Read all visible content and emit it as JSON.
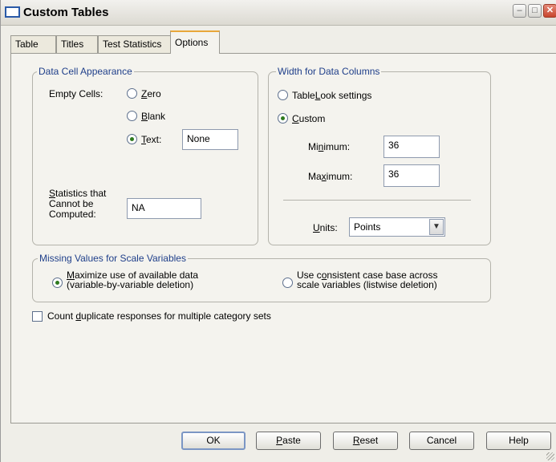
{
  "window": {
    "title": "Custom Tables",
    "controls": {
      "minimize": "–",
      "maximize": "□",
      "close": "✕"
    }
  },
  "tabs": [
    {
      "label": "Table",
      "active": false
    },
    {
      "label": "Titles",
      "active": false
    },
    {
      "label": "Test Statistics",
      "active": false
    },
    {
      "label": "Options",
      "active": true
    }
  ],
  "data_cell": {
    "legend": "Data Cell Appearance",
    "empty_cells_label": "Empty Cells:",
    "opt_zero": {
      "pre": "",
      "key": "Z",
      "post": "ero",
      "selected": false
    },
    "opt_blank": {
      "pre": "",
      "key": "B",
      "post": "lank",
      "selected": false
    },
    "opt_text": {
      "pre": "",
      "key": "T",
      "post": "ext:",
      "selected": true
    },
    "text_value": "None",
    "stats_label_key": "S",
    "stats_label_line1": "tatistics that",
    "stats_label_line2": "Cannot be",
    "stats_label_line3": "Computed:",
    "stats_value": "NA"
  },
  "width_cols": {
    "legend": "Width for Data Columns",
    "opt_tablelook": {
      "pre": "Table",
      "key": "L",
      "post": "ook settings",
      "selected": false
    },
    "opt_custom": {
      "pre": "",
      "key": "C",
      "post": "ustom",
      "selected": true
    },
    "min_label": {
      "pre": "Mi",
      "key": "n",
      "post": "imum:"
    },
    "min_value": "36",
    "max_label": {
      "pre": "Ma",
      "key": "x",
      "post": "imum:"
    },
    "max_value": "36",
    "units_label": {
      "pre": "",
      "key": "U",
      "post": "nits:"
    },
    "units_value": "Points"
  },
  "missing": {
    "legend": "Missing Values for Scale Variables",
    "opt_maximize": {
      "pre": "",
      "key": "M",
      "post": "aximize use of available data",
      "line2": "(variable-by-variable deletion)",
      "selected": true
    },
    "opt_consistent": {
      "pre": "Use c",
      "key": "o",
      "post": "nsistent case base across",
      "line2": "scale variables (listwise deletion)",
      "selected": false
    }
  },
  "count_dup": {
    "pre": "Count ",
    "key": "d",
    "post": "uplicate responses for multiple category sets",
    "checked": false
  },
  "buttons": {
    "ok": "OK",
    "paste": {
      "pre": "",
      "key": "P",
      "post": "aste"
    },
    "reset": {
      "pre": "",
      "key": "R",
      "post": "eset"
    },
    "cancel": "Cancel",
    "help": "Help"
  }
}
